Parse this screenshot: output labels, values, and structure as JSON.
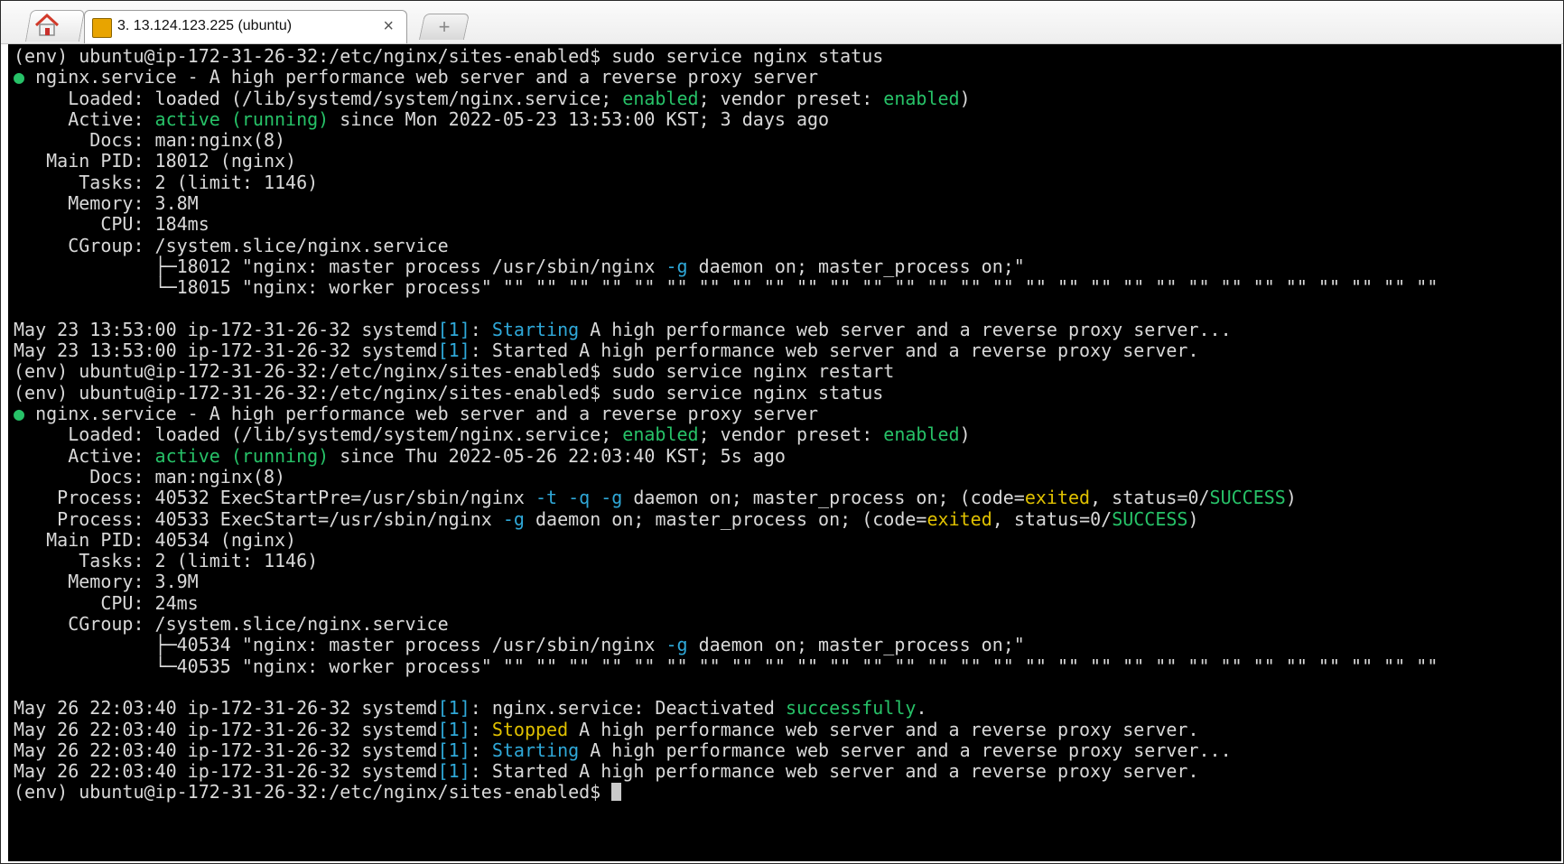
{
  "tab": {
    "title": "3. 13.124.123.225 (ubuntu)",
    "close": "×",
    "new_tab": "+"
  },
  "colors": {
    "green": "#27c268",
    "cyan": "#2fa8d8",
    "yellow": "#e0c100",
    "text": "#d9d9d9",
    "background": "#000000"
  },
  "terminal": {
    "lines": [
      [
        {
          "t": "(env) ubuntu@ip-172-31-26-32:/etc/nginx/sites-enabled$ sudo service nginx status"
        }
      ],
      [
        {
          "t": "●",
          "c": "g"
        },
        {
          "t": " nginx.service - A high performance web server and a reverse proxy server"
        }
      ],
      [
        {
          "t": "     Loaded: loaded (/lib/systemd/system/nginx.service; "
        },
        {
          "t": "enabled",
          "c": "g"
        },
        {
          "t": "; vendor preset: "
        },
        {
          "t": "enabled",
          "c": "g"
        },
        {
          "t": ")"
        }
      ],
      [
        {
          "t": "     Active: "
        },
        {
          "t": "active (running)",
          "c": "g"
        },
        {
          "t": " since Mon 2022-05-23 13:53:00 KST; 3 days ago"
        }
      ],
      [
        {
          "t": "       Docs: man:nginx(8)"
        }
      ],
      [
        {
          "t": "   Main PID: 18012 (nginx)"
        }
      ],
      [
        {
          "t": "      Tasks: 2 (limit: 1146)"
        }
      ],
      [
        {
          "t": "     Memory: 3.8M"
        }
      ],
      [
        {
          "t": "        CPU: 184ms"
        }
      ],
      [
        {
          "t": "     CGroup: /system.slice/nginx.service"
        }
      ],
      [
        {
          "t": "             ├─18012 \"nginx: master process /usr/sbin/nginx "
        },
        {
          "t": "-g",
          "c": "c"
        },
        {
          "t": " daemon on; master_process on;\""
        }
      ],
      [
        {
          "t": "             └─18015 \"nginx: worker process\" \"\" \"\" \"\" \"\" \"\" \"\" \"\" \"\" \"\" \"\" \"\" \"\" \"\" \"\" \"\" \"\" \"\" \"\" \"\" \"\" \"\" \"\" \"\" \"\" \"\" \"\" \"\" \"\" \"\""
        }
      ],
      [
        {
          "t": ""
        }
      ],
      [
        {
          "t": "May 23 13:53:00 ip-172-31-26-32 systemd"
        },
        {
          "t": "[1]",
          "c": "c"
        },
        {
          "t": ": "
        },
        {
          "t": "Starting",
          "c": "c"
        },
        {
          "t": " A high performance web server and a reverse proxy server..."
        }
      ],
      [
        {
          "t": "May 23 13:53:00 ip-172-31-26-32 systemd"
        },
        {
          "t": "[1]",
          "c": "c"
        },
        {
          "t": ": Started A high performance web server and a reverse proxy server."
        }
      ],
      [
        {
          "t": "(env) ubuntu@ip-172-31-26-32:/etc/nginx/sites-enabled$ sudo service nginx restart"
        }
      ],
      [
        {
          "t": "(env) ubuntu@ip-172-31-26-32:/etc/nginx/sites-enabled$ sudo service nginx status"
        }
      ],
      [
        {
          "t": "●",
          "c": "g"
        },
        {
          "t": " nginx.service - A high performance web server and a reverse proxy server"
        }
      ],
      [
        {
          "t": "     Loaded: loaded (/lib/systemd/system/nginx.service; "
        },
        {
          "t": "enabled",
          "c": "g"
        },
        {
          "t": "; vendor preset: "
        },
        {
          "t": "enabled",
          "c": "g"
        },
        {
          "t": ")"
        }
      ],
      [
        {
          "t": "     Active: "
        },
        {
          "t": "active (running)",
          "c": "g"
        },
        {
          "t": " since Thu 2022-05-26 22:03:40 KST; 5s ago"
        }
      ],
      [
        {
          "t": "       Docs: man:nginx(8)"
        }
      ],
      [
        {
          "t": "    Process: 40532 ExecStartPre=/usr/sbin/nginx "
        },
        {
          "t": "-t -q -g",
          "c": "c"
        },
        {
          "t": " daemon on; master_process on; (code="
        },
        {
          "t": "exited",
          "c": "y"
        },
        {
          "t": ", status=0/"
        },
        {
          "t": "SUCCESS",
          "c": "g"
        },
        {
          "t": ")"
        }
      ],
      [
        {
          "t": "    Process: 40533 ExecStart=/usr/sbin/nginx "
        },
        {
          "t": "-g",
          "c": "c"
        },
        {
          "t": " daemon on; master_process on; (code="
        },
        {
          "t": "exited",
          "c": "y"
        },
        {
          "t": ", status=0/"
        },
        {
          "t": "SUCCESS",
          "c": "g"
        },
        {
          "t": ")"
        }
      ],
      [
        {
          "t": "   Main PID: 40534 (nginx)"
        }
      ],
      [
        {
          "t": "      Tasks: 2 (limit: 1146)"
        }
      ],
      [
        {
          "t": "     Memory: 3.9M"
        }
      ],
      [
        {
          "t": "        CPU: 24ms"
        }
      ],
      [
        {
          "t": "     CGroup: /system.slice/nginx.service"
        }
      ],
      [
        {
          "t": "             ├─40534 \"nginx: master process /usr/sbin/nginx "
        },
        {
          "t": "-g",
          "c": "c"
        },
        {
          "t": " daemon on; master_process on;\""
        }
      ],
      [
        {
          "t": "             └─40535 \"nginx: worker process\" \"\" \"\" \"\" \"\" \"\" \"\" \"\" \"\" \"\" \"\" \"\" \"\" \"\" \"\" \"\" \"\" \"\" \"\" \"\" \"\" \"\" \"\" \"\" \"\" \"\" \"\" \"\" \"\" \"\""
        }
      ],
      [
        {
          "t": ""
        }
      ],
      [
        {
          "t": "May 26 22:03:40 ip-172-31-26-32 systemd"
        },
        {
          "t": "[1]",
          "c": "c"
        },
        {
          "t": ": nginx.service: Deactivated "
        },
        {
          "t": "successfully",
          "c": "g"
        },
        {
          "t": "."
        }
      ],
      [
        {
          "t": "May 26 22:03:40 ip-172-31-26-32 systemd"
        },
        {
          "t": "[1]",
          "c": "c"
        },
        {
          "t": ": "
        },
        {
          "t": "Stopped",
          "c": "y"
        },
        {
          "t": " A high performance web server and a reverse proxy server."
        }
      ],
      [
        {
          "t": "May 26 22:03:40 ip-172-31-26-32 systemd"
        },
        {
          "t": "[1]",
          "c": "c"
        },
        {
          "t": ": "
        },
        {
          "t": "Starting",
          "c": "c"
        },
        {
          "t": " A high performance web server and a reverse proxy server..."
        }
      ],
      [
        {
          "t": "May 26 22:03:40 ip-172-31-26-32 systemd"
        },
        {
          "t": "[1]",
          "c": "c"
        },
        {
          "t": ": Started A high performance web server and a reverse proxy server."
        }
      ],
      [
        {
          "t": "(env) ubuntu@ip-172-31-26-32:/etc/nginx/sites-enabled$ "
        }
      ]
    ]
  }
}
